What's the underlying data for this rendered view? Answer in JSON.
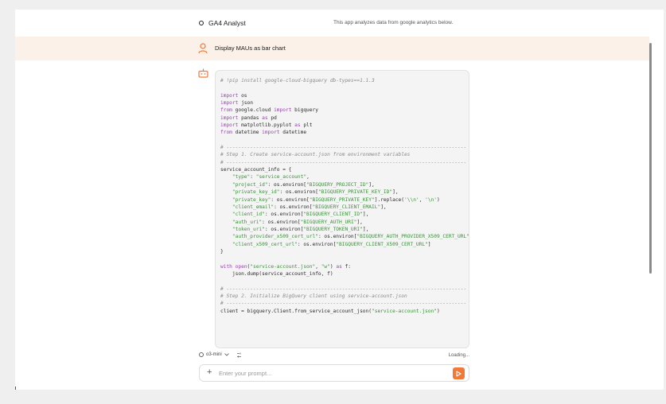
{
  "header": {
    "title": "GA4 Analyst",
    "description": "This app analyzes data from google analytics below."
  },
  "user_message": {
    "text": "Display MAUs as bar chart",
    "icon": "user-icon"
  },
  "assistant": {
    "icon": "bot-icon",
    "code_lines": [
      {
        "t": "comment",
        "s": "# !pip install google-cloud-bigquery db-types==1.1.3"
      },
      {
        "t": "blank",
        "s": ""
      },
      {
        "t": "mixed",
        "parts": [
          [
            "kw",
            "import"
          ],
          [
            "plain",
            " os"
          ]
        ]
      },
      {
        "t": "mixed",
        "parts": [
          [
            "kw",
            "import"
          ],
          [
            "plain",
            " json"
          ]
        ]
      },
      {
        "t": "mixed",
        "parts": [
          [
            "kw",
            "from"
          ],
          [
            "plain",
            " google.cloud "
          ],
          [
            "kw",
            "import"
          ],
          [
            "plain",
            " bigquery"
          ]
        ]
      },
      {
        "t": "mixed",
        "parts": [
          [
            "kw",
            "import"
          ],
          [
            "plain",
            " pandas "
          ],
          [
            "kw",
            "as"
          ],
          [
            "plain",
            " pd"
          ]
        ]
      },
      {
        "t": "mixed",
        "parts": [
          [
            "kw",
            "import"
          ],
          [
            "plain",
            " matplotlib.pyplot "
          ],
          [
            "kw",
            "as"
          ],
          [
            "plain",
            " plt"
          ]
        ]
      },
      {
        "t": "mixed",
        "parts": [
          [
            "kw",
            "from"
          ],
          [
            "plain",
            " datetime "
          ],
          [
            "kw",
            "import"
          ],
          [
            "plain",
            " datetime"
          ]
        ]
      },
      {
        "t": "blank",
        "s": ""
      },
      {
        "t": "comment",
        "s": "# ---------------------------------------------------------------------------------"
      },
      {
        "t": "comment",
        "s": "# Step 1. Create service-account.json from environment variables"
      },
      {
        "t": "comment",
        "s": "# ---------------------------------------------------------------------------------"
      },
      {
        "t": "mixed",
        "parts": [
          [
            "plain",
            "service_account_info = {"
          ]
        ]
      },
      {
        "t": "mixed",
        "parts": [
          [
            "plain",
            "    "
          ],
          [
            "str",
            "\"type\""
          ],
          [
            "plain",
            ": "
          ],
          [
            "str",
            "\"service_account\""
          ],
          [
            "plain",
            ","
          ]
        ]
      },
      {
        "t": "mixed",
        "parts": [
          [
            "plain",
            "    "
          ],
          [
            "str",
            "\"project_id\""
          ],
          [
            "plain",
            ": os.environ["
          ],
          [
            "str",
            "\"BIGQUERY_PROJECT_ID\""
          ],
          [
            "plain",
            "],"
          ]
        ]
      },
      {
        "t": "mixed",
        "parts": [
          [
            "plain",
            "    "
          ],
          [
            "str",
            "\"private_key_id\""
          ],
          [
            "plain",
            ": os.environ["
          ],
          [
            "str",
            "\"BIGQUERY_PRIVATE_KEY_ID\""
          ],
          [
            "plain",
            "],"
          ]
        ]
      },
      {
        "t": "mixed",
        "parts": [
          [
            "plain",
            "    "
          ],
          [
            "str",
            "\"private_key\""
          ],
          [
            "plain",
            ": os.environ["
          ],
          [
            "str",
            "\"BIGQUERY_PRIVATE_KEY\""
          ],
          [
            "plain",
            "].replace("
          ],
          [
            "str",
            "'\\\\n'"
          ],
          [
            "plain",
            ", "
          ],
          [
            "str",
            "'\\n'"
          ],
          [
            "plain",
            ")"
          ]
        ]
      },
      {
        "t": "mixed",
        "parts": [
          [
            "plain",
            "    "
          ],
          [
            "str",
            "\"client_email\""
          ],
          [
            "plain",
            ": os.environ["
          ],
          [
            "str",
            "\"BIGQUERY_CLIENT_EMAIL\""
          ],
          [
            "plain",
            "],"
          ]
        ]
      },
      {
        "t": "mixed",
        "parts": [
          [
            "plain",
            "    "
          ],
          [
            "str",
            "\"client_id\""
          ],
          [
            "plain",
            ": os.environ["
          ],
          [
            "str",
            "\"BIGQUERY_CLIENT_ID\""
          ],
          [
            "plain",
            "],"
          ]
        ]
      },
      {
        "t": "mixed",
        "parts": [
          [
            "plain",
            "    "
          ],
          [
            "str",
            "\"auth_uri\""
          ],
          [
            "plain",
            ": os.environ["
          ],
          [
            "str",
            "\"BIGQUERY_AUTH_URI\""
          ],
          [
            "plain",
            "],"
          ]
        ]
      },
      {
        "t": "mixed",
        "parts": [
          [
            "plain",
            "    "
          ],
          [
            "str",
            "\"token_uri\""
          ],
          [
            "plain",
            ": os.environ["
          ],
          [
            "str",
            "\"BIGQUERY_TOKEN_URI\""
          ],
          [
            "plain",
            "],"
          ]
        ]
      },
      {
        "t": "mixed",
        "parts": [
          [
            "plain",
            "    "
          ],
          [
            "str",
            "\"auth_provider_x509_cert_url\""
          ],
          [
            "plain",
            ": os.environ["
          ],
          [
            "str",
            "\"BIGQUERY_AUTH_PROVIDER_X509_CERT_URL\""
          ],
          [
            "plain",
            "],"
          ]
        ]
      },
      {
        "t": "mixed",
        "parts": [
          [
            "plain",
            "    "
          ],
          [
            "str",
            "\"client_x509_cert_url\""
          ],
          [
            "plain",
            ": os.environ["
          ],
          [
            "str",
            "\"BIGQUERY_CLIENT_X509_CERT_URL\""
          ],
          [
            "plain",
            "]"
          ]
        ]
      },
      {
        "t": "mixed",
        "parts": [
          [
            "plain",
            "}"
          ]
        ]
      },
      {
        "t": "blank",
        "s": ""
      },
      {
        "t": "mixed",
        "parts": [
          [
            "kw",
            "with"
          ],
          [
            "plain",
            " "
          ],
          [
            "kw",
            "open"
          ],
          [
            "plain",
            "("
          ],
          [
            "str",
            "\"service-account.json\""
          ],
          [
            "plain",
            ", "
          ],
          [
            "str",
            "\"w\""
          ],
          [
            "plain",
            ") "
          ],
          [
            "kw",
            "as"
          ],
          [
            "plain",
            " f:"
          ]
        ]
      },
      {
        "t": "mixed",
        "parts": [
          [
            "plain",
            "    json.dump(service_account_info, f)"
          ]
        ]
      },
      {
        "t": "blank",
        "s": ""
      },
      {
        "t": "comment",
        "s": "# ---------------------------------------------------------------------------------"
      },
      {
        "t": "comment",
        "s": "# Step 2. Initialize BigQuery client using service-account.json"
      },
      {
        "t": "comment",
        "s": "# ---------------------------------------------------------------------------------"
      },
      {
        "t": "mixed",
        "parts": [
          [
            "plain",
            "client = bigquery.Client.from_service_account_json("
          ],
          [
            "str",
            "\"service-account.json\""
          ],
          [
            "plain",
            ")"
          ]
        ]
      }
    ]
  },
  "toolbar": {
    "model_label": "o3-mini",
    "model_icon": "gear-icon",
    "tools_icon": "tools-icon",
    "status": "Loading..."
  },
  "composer": {
    "placeholder": "Enter your prompt...",
    "value": "",
    "add_icon": "plus-icon",
    "send_icon": "send-icon",
    "send_color": "#f07a3a"
  },
  "colors": {
    "user_bg": "#fbf1e8",
    "accent": "#f07a3a"
  }
}
